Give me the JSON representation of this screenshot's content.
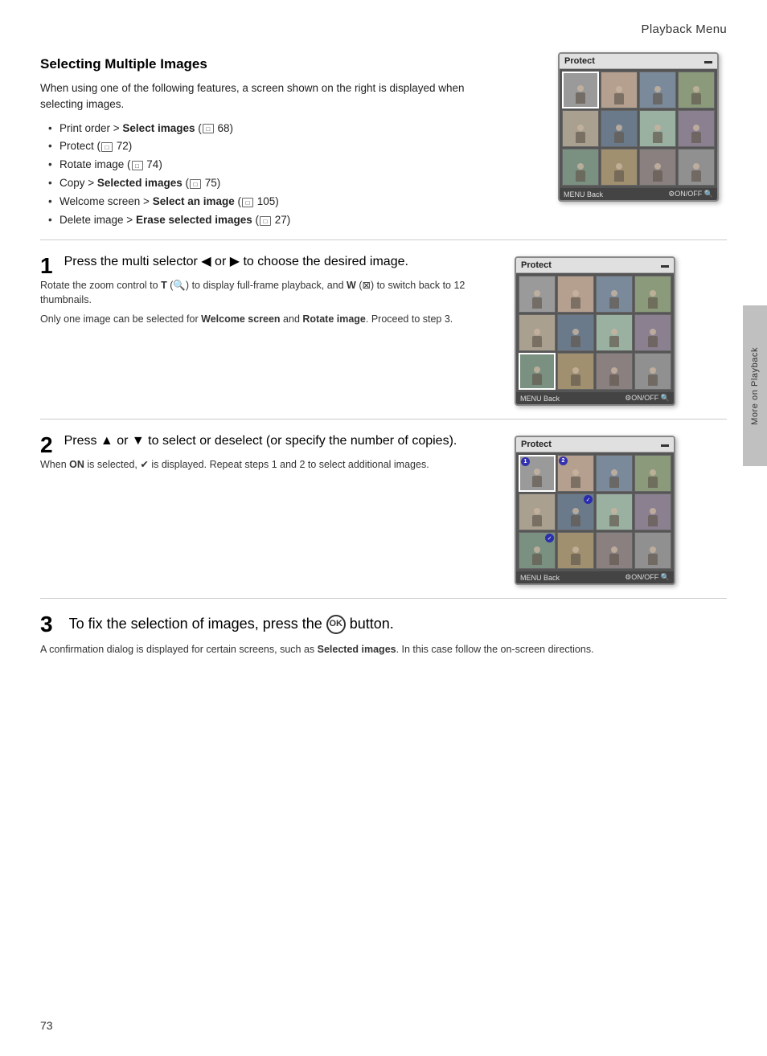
{
  "header": {
    "title": "Playback Menu"
  },
  "section": {
    "heading": "Selecting Multiple Images",
    "intro": "When using one of the following features, a screen shown on the right is displayed when selecting images.",
    "bullets": [
      {
        "text": "Print order > ",
        "bold": "Select images",
        "suffix": " ( 68)"
      },
      {
        "text": "Protect ( 72)",
        "bold": null,
        "suffix": null
      },
      {
        "text": "Rotate image ( 74)",
        "bold": null,
        "suffix": null
      },
      {
        "text": "Copy > ",
        "bold": "Selected images",
        "suffix": " ( 75)"
      },
      {
        "text": "Welcome screen > ",
        "bold": "Select an image",
        "suffix": " ( 105)"
      },
      {
        "text": "Delete image > ",
        "bold": "Erase selected images",
        "suffix": " ( 27)"
      }
    ]
  },
  "steps": [
    {
      "number": "1",
      "main": "Press the multi selector ◄ or ► to choose the desired image.",
      "sub1": "Rotate the zoom control to T (🔍) to display full-frame playback, and W (⋣) to switch back to 12 thumbnails.",
      "sub2": "Only one image can be selected for <strong>Welcome screen</strong> and <strong>Rotate image</strong>. Proceed to step 3."
    },
    {
      "number": "2",
      "main": "Press ▲ or ▼ to select or deselect (or specify the number of copies).",
      "sub1": "When <strong>ON</strong> is selected, ✔ is displayed. Repeat steps 1 and 2 to select additional images.",
      "sub2": null
    }
  ],
  "step3": {
    "number": "3",
    "main_prefix": "To fix the selection of images, press the ",
    "ok_label": "OK",
    "main_suffix": " button.",
    "sub": "A confirmation dialog is displayed for certain screens, such as <strong>Selected images</strong>. In this case follow the on-screen directions."
  },
  "screens": [
    {
      "label": "screen1",
      "header": "Protect",
      "highlighted_index": 0,
      "selected_indices": [],
      "numbered": {}
    },
    {
      "label": "screen2",
      "header": "Protect",
      "highlighted_index": 8,
      "selected_indices": [],
      "numbered": {}
    },
    {
      "label": "screen3",
      "header": "Protect",
      "highlighted_index": 0,
      "selected_indices": [
        0,
        1,
        5,
        8
      ],
      "numbered": {
        "0": "1",
        "1": "2"
      }
    }
  ],
  "sidebar_tab": "More on Playback",
  "page_number": "73"
}
